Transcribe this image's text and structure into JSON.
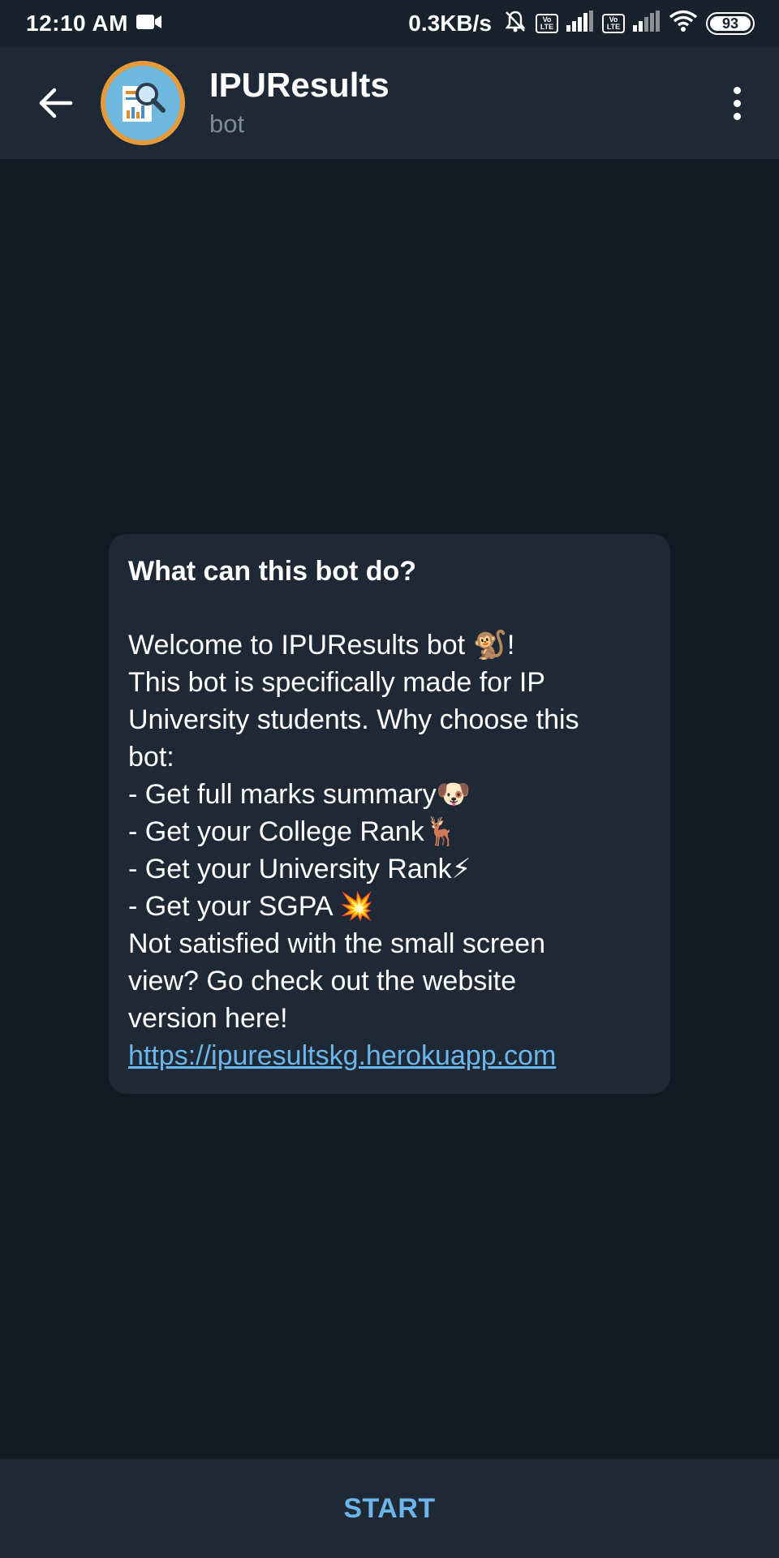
{
  "status_bar": {
    "time": "12:10 AM",
    "net_speed": "0.3KB/s",
    "battery": "93",
    "volte_label": "Vo LTE"
  },
  "header": {
    "title": "IPUResults",
    "subtitle": "bot"
  },
  "message": {
    "title": "What can this bot do?",
    "lines": [
      "Welcome to IPUResults bot 🐒!",
      "This bot is specifically made for IP",
      "University students. Why choose this",
      "bot:",
      "- Get full marks summary🐶",
      "- Get your College Rank🦌",
      "- Get your University Rank⚡",
      "- Get your SGPA 💥",
      "Not satisfied with the small screen",
      "view? Go check out the website",
      "version here!"
    ],
    "link": "https://ipuresultskg.herokuapp.com"
  },
  "start_button": {
    "label": "START"
  },
  "colors": {
    "background": "#111a23",
    "header": "#1f2936",
    "card": "#1e2935",
    "accent": "#6cb5e8"
  },
  "icons": {
    "back": "back-arrow-icon",
    "menu": "more-vertical-icon",
    "video": "video-camera-icon",
    "mute": "bell-muted-icon",
    "signal": "signal-icon",
    "wifi": "wifi-icon",
    "battery": "battery-icon"
  }
}
